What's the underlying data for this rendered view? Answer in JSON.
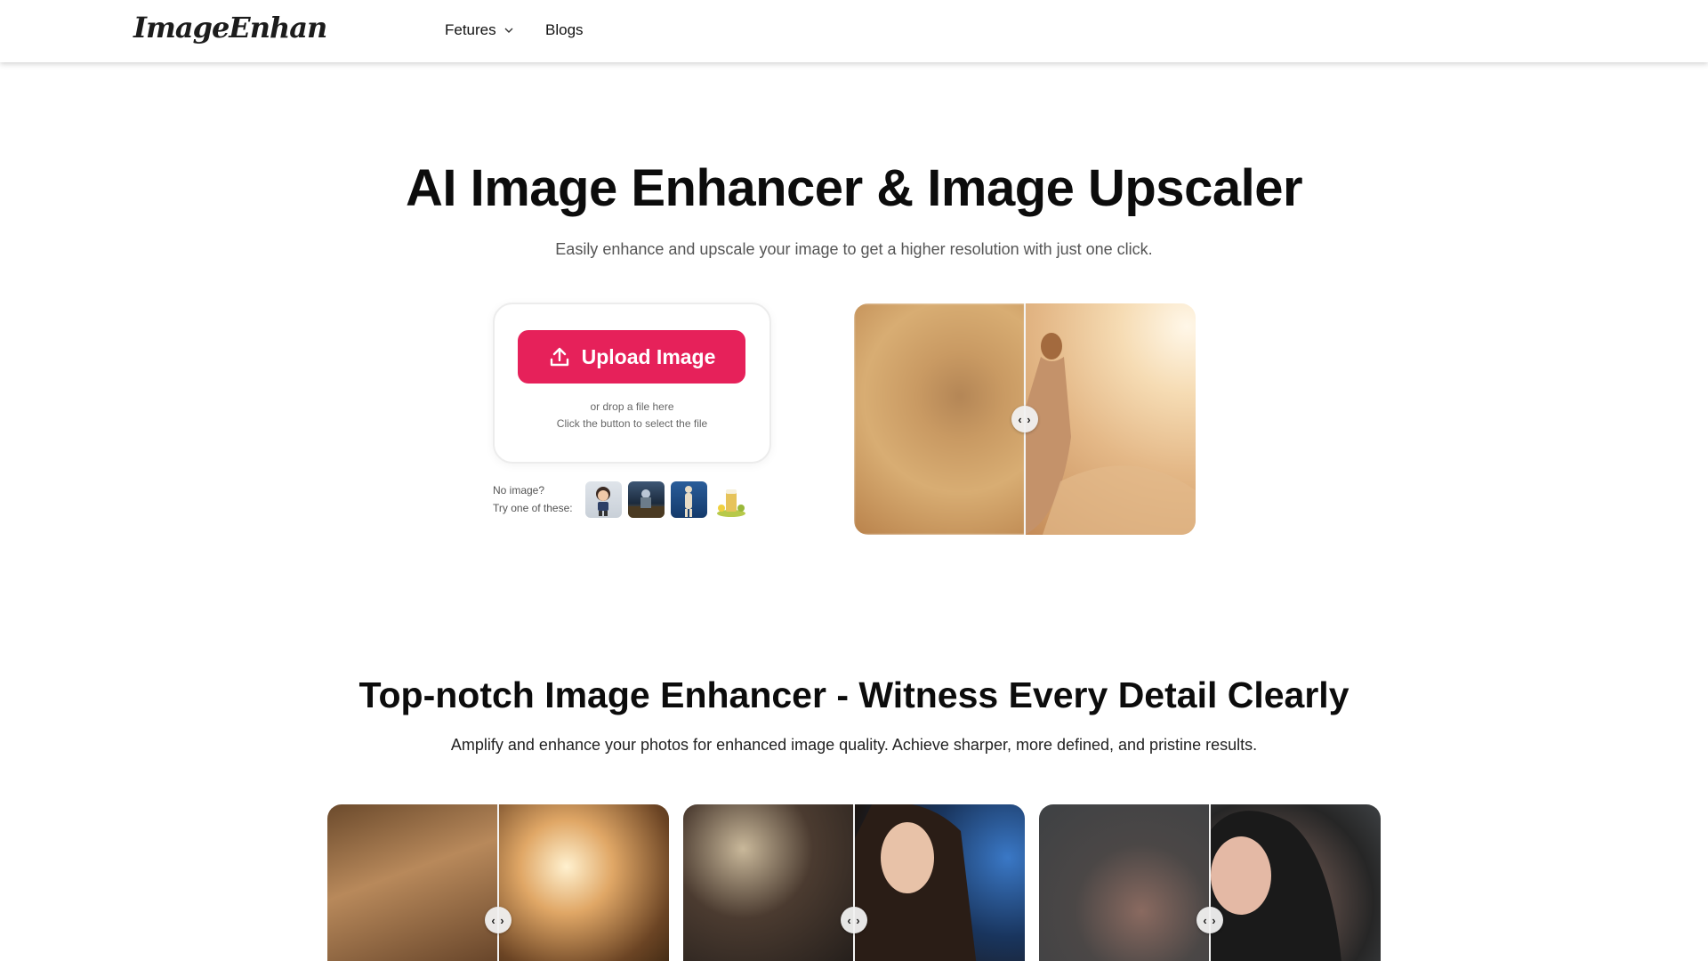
{
  "header": {
    "logo_text": "ImageEnhan",
    "nav": [
      {
        "label": "Fetures",
        "has_dropdown": true
      },
      {
        "label": "Blogs",
        "has_dropdown": false
      }
    ]
  },
  "hero": {
    "title": "AI Image Enhancer & Image Upscaler",
    "subtitle": "Easily enhance and upscale your image to get a higher resolution with just one click.",
    "upload_button": "Upload Image",
    "drop_hint": "or drop a file here",
    "click_hint": "Click the button to select the file",
    "samples_label_1": "No image?",
    "samples_label_2": "Try one of these:",
    "compare_handle": "‹ ›"
  },
  "section2": {
    "title": "Top-notch Image Enhancer - Witness Every Detail Clearly",
    "subtitle": "Amplify and enhance your photos for enhanced image quality. Achieve sharper, more defined, and pristine results."
  },
  "colors": {
    "accent": "#e6215a",
    "text": "#111111",
    "muted": "#555555"
  },
  "icons": {
    "upload": "upload-icon",
    "chevron": "chevron-down-icon",
    "compare": "compare-arrows-icon"
  }
}
